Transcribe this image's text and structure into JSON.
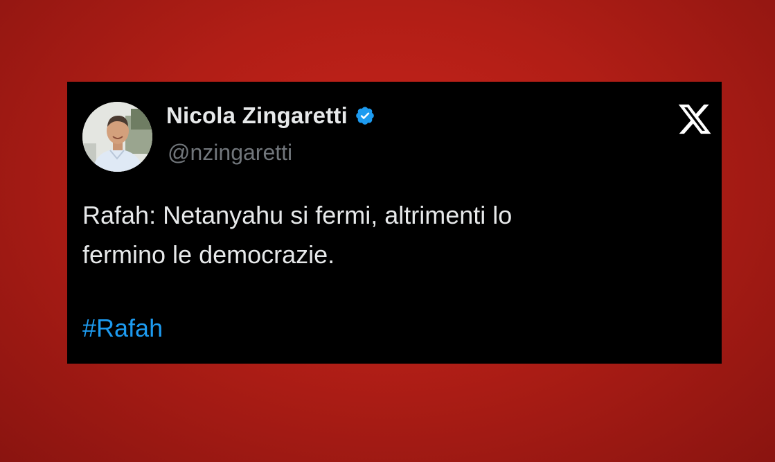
{
  "tweet": {
    "author_name": "Nicola Zingaretti",
    "handle": "@nzingaretti",
    "text": "Rafah: Netanyahu si fermi, altrimenti lo\nfermino le democrazie.",
    "hashtag": "#Rafah",
    "verified": true
  },
  "icons": {
    "verified": "verified-badge-icon",
    "platform": "x-logo-icon"
  },
  "colors": {
    "background": "#b11e16",
    "card": "#000000",
    "text": "#e7e9ea",
    "handle": "#71767b",
    "link": "#1d9bf0",
    "verified": "#1d9bf0"
  }
}
